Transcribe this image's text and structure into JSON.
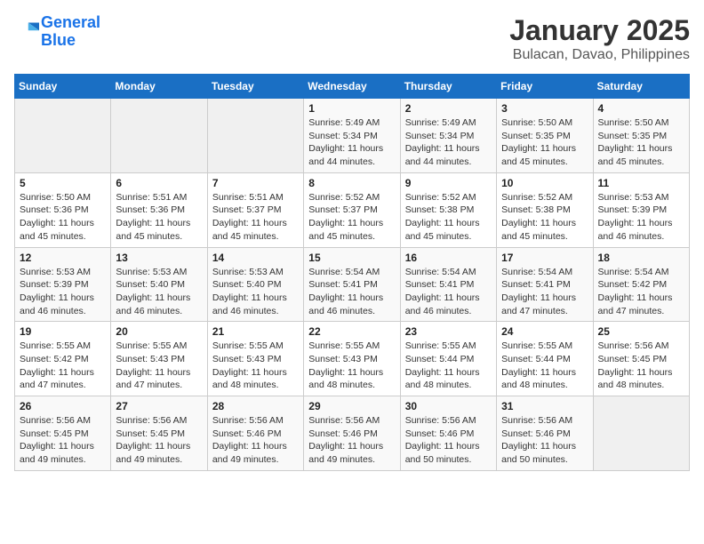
{
  "header": {
    "logo_line1": "General",
    "logo_line2": "Blue",
    "title": "January 2025",
    "subtitle": "Bulacan, Davao, Philippines"
  },
  "weekdays": [
    "Sunday",
    "Monday",
    "Tuesday",
    "Wednesday",
    "Thursday",
    "Friday",
    "Saturday"
  ],
  "weeks": [
    [
      {
        "day": "",
        "sunrise": "",
        "sunset": "",
        "daylight": ""
      },
      {
        "day": "",
        "sunrise": "",
        "sunset": "",
        "daylight": ""
      },
      {
        "day": "",
        "sunrise": "",
        "sunset": "",
        "daylight": ""
      },
      {
        "day": "1",
        "sunrise": "Sunrise: 5:49 AM",
        "sunset": "Sunset: 5:34 PM",
        "daylight": "Daylight: 11 hours and 44 minutes."
      },
      {
        "day": "2",
        "sunrise": "Sunrise: 5:49 AM",
        "sunset": "Sunset: 5:34 PM",
        "daylight": "Daylight: 11 hours and 44 minutes."
      },
      {
        "day": "3",
        "sunrise": "Sunrise: 5:50 AM",
        "sunset": "Sunset: 5:35 PM",
        "daylight": "Daylight: 11 hours and 45 minutes."
      },
      {
        "day": "4",
        "sunrise": "Sunrise: 5:50 AM",
        "sunset": "Sunset: 5:35 PM",
        "daylight": "Daylight: 11 hours and 45 minutes."
      }
    ],
    [
      {
        "day": "5",
        "sunrise": "Sunrise: 5:50 AM",
        "sunset": "Sunset: 5:36 PM",
        "daylight": "Daylight: 11 hours and 45 minutes."
      },
      {
        "day": "6",
        "sunrise": "Sunrise: 5:51 AM",
        "sunset": "Sunset: 5:36 PM",
        "daylight": "Daylight: 11 hours and 45 minutes."
      },
      {
        "day": "7",
        "sunrise": "Sunrise: 5:51 AM",
        "sunset": "Sunset: 5:37 PM",
        "daylight": "Daylight: 11 hours and 45 minutes."
      },
      {
        "day": "8",
        "sunrise": "Sunrise: 5:52 AM",
        "sunset": "Sunset: 5:37 PM",
        "daylight": "Daylight: 11 hours and 45 minutes."
      },
      {
        "day": "9",
        "sunrise": "Sunrise: 5:52 AM",
        "sunset": "Sunset: 5:38 PM",
        "daylight": "Daylight: 11 hours and 45 minutes."
      },
      {
        "day": "10",
        "sunrise": "Sunrise: 5:52 AM",
        "sunset": "Sunset: 5:38 PM",
        "daylight": "Daylight: 11 hours and 45 minutes."
      },
      {
        "day": "11",
        "sunrise": "Sunrise: 5:53 AM",
        "sunset": "Sunset: 5:39 PM",
        "daylight": "Daylight: 11 hours and 46 minutes."
      }
    ],
    [
      {
        "day": "12",
        "sunrise": "Sunrise: 5:53 AM",
        "sunset": "Sunset: 5:39 PM",
        "daylight": "Daylight: 11 hours and 46 minutes."
      },
      {
        "day": "13",
        "sunrise": "Sunrise: 5:53 AM",
        "sunset": "Sunset: 5:40 PM",
        "daylight": "Daylight: 11 hours and 46 minutes."
      },
      {
        "day": "14",
        "sunrise": "Sunrise: 5:53 AM",
        "sunset": "Sunset: 5:40 PM",
        "daylight": "Daylight: 11 hours and 46 minutes."
      },
      {
        "day": "15",
        "sunrise": "Sunrise: 5:54 AM",
        "sunset": "Sunset: 5:41 PM",
        "daylight": "Daylight: 11 hours and 46 minutes."
      },
      {
        "day": "16",
        "sunrise": "Sunrise: 5:54 AM",
        "sunset": "Sunset: 5:41 PM",
        "daylight": "Daylight: 11 hours and 46 minutes."
      },
      {
        "day": "17",
        "sunrise": "Sunrise: 5:54 AM",
        "sunset": "Sunset: 5:41 PM",
        "daylight": "Daylight: 11 hours and 47 minutes."
      },
      {
        "day": "18",
        "sunrise": "Sunrise: 5:54 AM",
        "sunset": "Sunset: 5:42 PM",
        "daylight": "Daylight: 11 hours and 47 minutes."
      }
    ],
    [
      {
        "day": "19",
        "sunrise": "Sunrise: 5:55 AM",
        "sunset": "Sunset: 5:42 PM",
        "daylight": "Daylight: 11 hours and 47 minutes."
      },
      {
        "day": "20",
        "sunrise": "Sunrise: 5:55 AM",
        "sunset": "Sunset: 5:43 PM",
        "daylight": "Daylight: 11 hours and 47 minutes."
      },
      {
        "day": "21",
        "sunrise": "Sunrise: 5:55 AM",
        "sunset": "Sunset: 5:43 PM",
        "daylight": "Daylight: 11 hours and 48 minutes."
      },
      {
        "day": "22",
        "sunrise": "Sunrise: 5:55 AM",
        "sunset": "Sunset: 5:43 PM",
        "daylight": "Daylight: 11 hours and 48 minutes."
      },
      {
        "day": "23",
        "sunrise": "Sunrise: 5:55 AM",
        "sunset": "Sunset: 5:44 PM",
        "daylight": "Daylight: 11 hours and 48 minutes."
      },
      {
        "day": "24",
        "sunrise": "Sunrise: 5:55 AM",
        "sunset": "Sunset: 5:44 PM",
        "daylight": "Daylight: 11 hours and 48 minutes."
      },
      {
        "day": "25",
        "sunrise": "Sunrise: 5:56 AM",
        "sunset": "Sunset: 5:45 PM",
        "daylight": "Daylight: 11 hours and 48 minutes."
      }
    ],
    [
      {
        "day": "26",
        "sunrise": "Sunrise: 5:56 AM",
        "sunset": "Sunset: 5:45 PM",
        "daylight": "Daylight: 11 hours and 49 minutes."
      },
      {
        "day": "27",
        "sunrise": "Sunrise: 5:56 AM",
        "sunset": "Sunset: 5:45 PM",
        "daylight": "Daylight: 11 hours and 49 minutes."
      },
      {
        "day": "28",
        "sunrise": "Sunrise: 5:56 AM",
        "sunset": "Sunset: 5:46 PM",
        "daylight": "Daylight: 11 hours and 49 minutes."
      },
      {
        "day": "29",
        "sunrise": "Sunrise: 5:56 AM",
        "sunset": "Sunset: 5:46 PM",
        "daylight": "Daylight: 11 hours and 49 minutes."
      },
      {
        "day": "30",
        "sunrise": "Sunrise: 5:56 AM",
        "sunset": "Sunset: 5:46 PM",
        "daylight": "Daylight: 11 hours and 50 minutes."
      },
      {
        "day": "31",
        "sunrise": "Sunrise: 5:56 AM",
        "sunset": "Sunset: 5:46 PM",
        "daylight": "Daylight: 11 hours and 50 minutes."
      },
      {
        "day": "",
        "sunrise": "",
        "sunset": "",
        "daylight": ""
      }
    ]
  ]
}
